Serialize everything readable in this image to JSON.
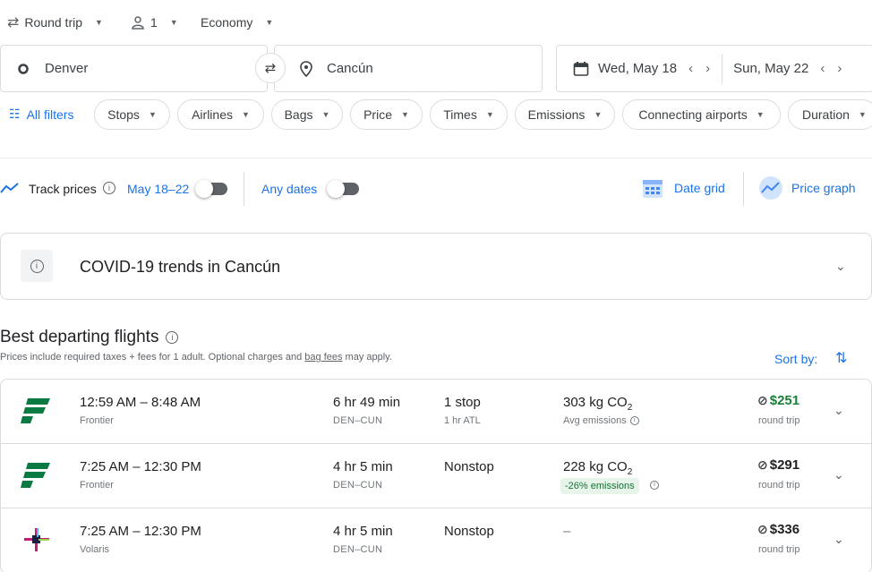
{
  "options": {
    "trip_type": "Round trip",
    "passengers": "1",
    "cabin": "Economy"
  },
  "search": {
    "origin": "Denver",
    "destination": "Cancún",
    "depart_date": "Wed, May 18",
    "return_date": "Sun, May 22"
  },
  "filters": {
    "all_filters": "All filters",
    "chips": [
      "Stops",
      "Airlines",
      "Bags",
      "Price",
      "Times",
      "Emissions",
      "Connecting airports",
      "Duration"
    ]
  },
  "track": {
    "label": "Track prices",
    "dates": "May 18–22",
    "any_dates": "Any dates",
    "date_grid": "Date grid",
    "price_graph": "Price graph"
  },
  "covid": {
    "title": "COVID-19 trends in Cancún"
  },
  "results": {
    "heading": "Best departing flights",
    "subtitle_pre": "Prices include required taxes + fees for 1 adult. Optional charges and ",
    "subtitle_link": "bag fees",
    "subtitle_post": " may apply.",
    "sort_label": "Sort by:",
    "flights": [
      {
        "time": "12:59 AM – 8:48 AM",
        "airline": "Frontier",
        "duration": "6 hr 49 min",
        "route": "DEN–CUN",
        "stops": "1 stop",
        "stop_detail": "1 hr ATL",
        "co2": "303 kg CO",
        "co2_sub": "2",
        "co2_note": "Avg emissions",
        "price": "$251",
        "price_type": "round trip",
        "price_color": "#188038",
        "logo": "frontier"
      },
      {
        "time": "7:25 AM – 12:30 PM",
        "airline": "Frontier",
        "duration": "4 hr 5 min",
        "route": "DEN–CUN",
        "stops": "Nonstop",
        "stop_detail": "",
        "co2": "228 kg CO",
        "co2_sub": "2",
        "co2_badge": "-26% emissions",
        "price": "$291",
        "price_type": "round trip",
        "price_color": "#202124",
        "logo": "frontier"
      },
      {
        "time": "7:25 AM – 12:30 PM",
        "airline": "Volaris",
        "duration": "4 hr 5 min",
        "route": "DEN–CUN",
        "stops": "Nonstop",
        "stop_detail": "",
        "co2": "–",
        "price": "$336",
        "price_type": "round trip",
        "price_color": "#202124",
        "logo": "volaris"
      }
    ]
  },
  "colors": {
    "accent": "#1a73e8",
    "frontier_green": "#0a7a43",
    "deal_green": "#188038",
    "badge_bg": "#e6f4ea"
  }
}
